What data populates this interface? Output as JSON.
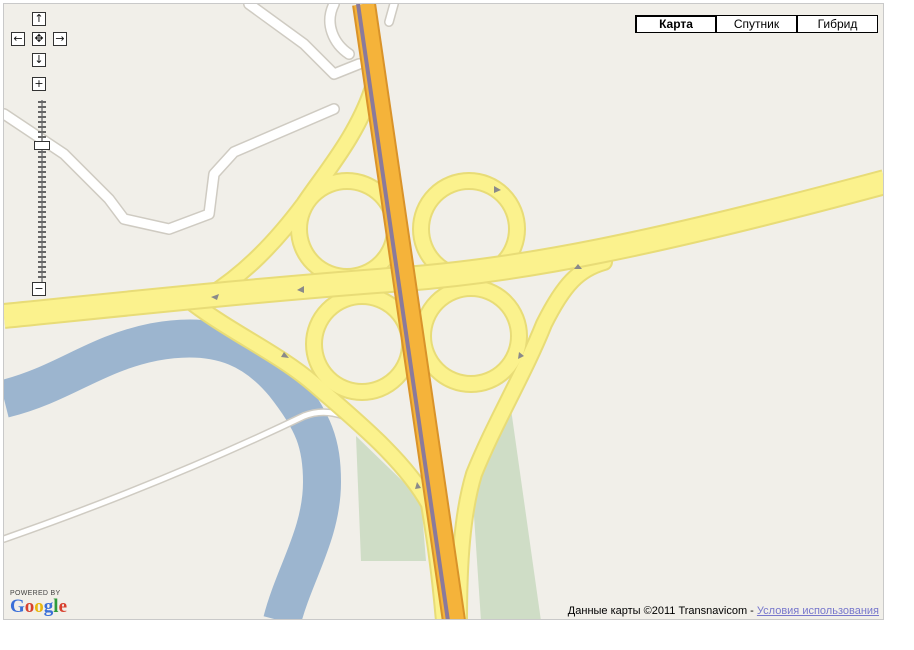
{
  "map_types": [
    {
      "label": "Карта",
      "active": true
    },
    {
      "label": "Спутник",
      "active": false
    },
    {
      "label": "Гибрид",
      "active": false
    }
  ],
  "pan_controls": {
    "up": "↑",
    "left": "←",
    "center": "✥",
    "right": "→",
    "down": "↓"
  },
  "zoom_controls": {
    "in": "+",
    "out": "−"
  },
  "logo": {
    "powered_by": "POWERED BY",
    "brand": "Google"
  },
  "attribution": {
    "data_text": "Данные карты ©2011 Transnavicom - ",
    "terms_link": "Условия использования"
  },
  "colors": {
    "map_background": "#f1efe9",
    "highway_fill": "#fbf28d",
    "motorway_fill": "#f5b33a",
    "rail_line": "#8a7a9c",
    "water": "#9cb5cf",
    "park": "#cfddc6",
    "minor_road_outline": "#d5d3ce"
  }
}
